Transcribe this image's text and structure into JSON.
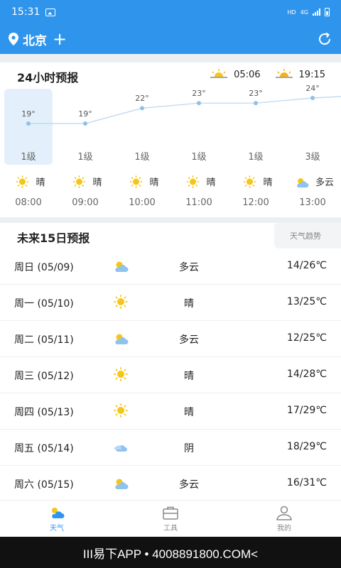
{
  "status": {
    "time": "15:31",
    "hd": "HD",
    "net": "4G"
  },
  "header": {
    "city": "北京",
    "add": "+"
  },
  "hourly": {
    "title": "24小时预报",
    "sunrise": "05:06",
    "sunset": "19:15",
    "hours": [
      {
        "time": "08:00",
        "temp": "19°",
        "temp_value": 19,
        "wind": "1级",
        "cond": "晴",
        "icon": "sun-icon"
      },
      {
        "time": "09:00",
        "temp": "19°",
        "temp_value": 19,
        "wind": "1级",
        "cond": "晴",
        "icon": "sun-icon"
      },
      {
        "time": "10:00",
        "temp": "22°",
        "temp_value": 22,
        "wind": "1级",
        "cond": "晴",
        "icon": "sun-icon"
      },
      {
        "time": "11:00",
        "temp": "23°",
        "temp_value": 23,
        "wind": "1级",
        "cond": "晴",
        "icon": "sun-icon"
      },
      {
        "time": "12:00",
        "temp": "23°",
        "temp_value": 23,
        "wind": "1级",
        "cond": "晴",
        "icon": "sun-icon"
      },
      {
        "time": "13:00",
        "temp": "24°",
        "temp_value": 24,
        "wind": "3级",
        "cond": "多云",
        "icon": "cloudy-icon"
      }
    ]
  },
  "daily": {
    "title": "未来15日预报",
    "trend_label": "天气趋势",
    "days": [
      {
        "day": "周日 (05/09)",
        "desc": "多云",
        "temp": "14/26℃",
        "icon": "cloudy-icon"
      },
      {
        "day": "周一 (05/10)",
        "desc": "晴",
        "temp": "13/25℃",
        "icon": "sun-icon"
      },
      {
        "day": "周二 (05/11)",
        "desc": "多云",
        "temp": "12/25℃",
        "icon": "cloudy-icon"
      },
      {
        "day": "周三 (05/12)",
        "desc": "晴",
        "temp": "14/28℃",
        "icon": "sun-icon"
      },
      {
        "day": "周四 (05/13)",
        "desc": "晴",
        "temp": "17/29℃",
        "icon": "sun-icon"
      },
      {
        "day": "周五 (05/14)",
        "desc": "阴",
        "temp": "18/29℃",
        "icon": "overcast-icon"
      },
      {
        "day": "周六 (05/15)",
        "desc": "多云",
        "temp": "16/31℃",
        "icon": "cloudy-icon"
      }
    ]
  },
  "nav": [
    {
      "label": "天气",
      "icon": "weather-icon",
      "active": true
    },
    {
      "label": "工具",
      "icon": "toolbox-icon",
      "active": false
    },
    {
      "label": "我的",
      "icon": "user-icon",
      "active": false
    }
  ],
  "watermark": "III易下APP • 4008891800.COM<",
  "colors": {
    "primary": "#2f95ec",
    "sun": "#f5c518",
    "cloud": "#7fb8ea"
  }
}
